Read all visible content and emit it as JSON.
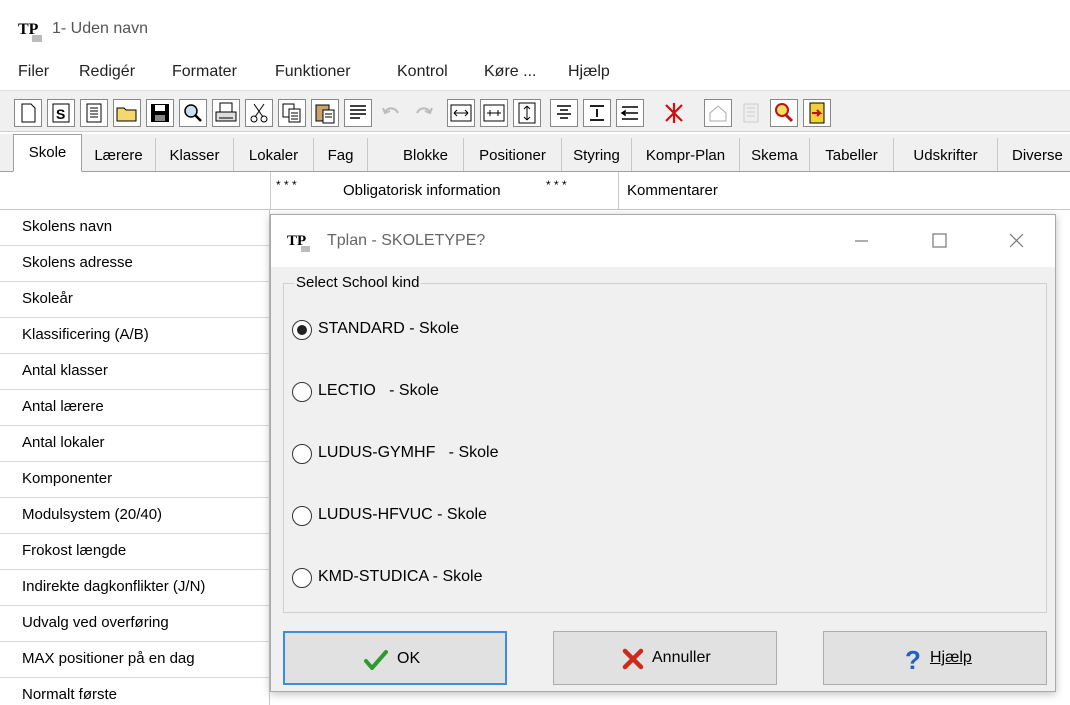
{
  "app": {
    "logo_text": "TP",
    "title": "1- Uden navn"
  },
  "menu": [
    "Filer",
    "Redigér",
    "Formater",
    "Funktioner",
    "Kontrol",
    "Køre ...",
    "Hjælp"
  ],
  "tabs": [
    "Skole",
    "Lærere",
    "Klasser",
    "Lokaler",
    "Fag",
    "Blokke",
    "Positioner",
    "Styring",
    "Kompr-Plan",
    "Skema",
    "Tabeller",
    "Udskrifter",
    "Diverse"
  ],
  "grid": {
    "header_stars_left": "* * *",
    "header_title": "Obligatorisk information",
    "header_stars_right": "* * *",
    "header_comments": "Kommentarer",
    "rows": [
      "Skolens navn",
      "Skolens adresse",
      "Skoleår",
      "Klassificering (A/B)",
      "Antal klasser",
      "Antal lærere",
      "Antal lokaler",
      "Komponenter",
      "Modulsystem (20/40)",
      "Frokost længde",
      "Indirekte dagkonflikter (J/N)",
      "Udvalg ved overføring",
      "MAX positioner på en dag",
      "Normalt første"
    ]
  },
  "dialog": {
    "logo_text": "TP",
    "title": "Tplan - SKOLETYPE?",
    "group_label": "Select School kind",
    "options": [
      {
        "label": "STANDARD - Skole",
        "selected": true
      },
      {
        "label": "LECTIO   - Skole",
        "selected": false
      },
      {
        "label": "LUDUS-GYMHF   - Skole",
        "selected": false
      },
      {
        "label": "LUDUS-HFVUC - Skole",
        "selected": false
      },
      {
        "label": "KMD-STUDICA - Skole",
        "selected": false
      }
    ],
    "ok_label": "OK",
    "cancel_label": "Annuller",
    "help_label": "Hjælp",
    "colors": {
      "ok_check": "#2e9a2e",
      "cancel_x": "#cc2a1a",
      "help_q": "#1f5fc6",
      "default_border": "#3c8ddb"
    }
  }
}
